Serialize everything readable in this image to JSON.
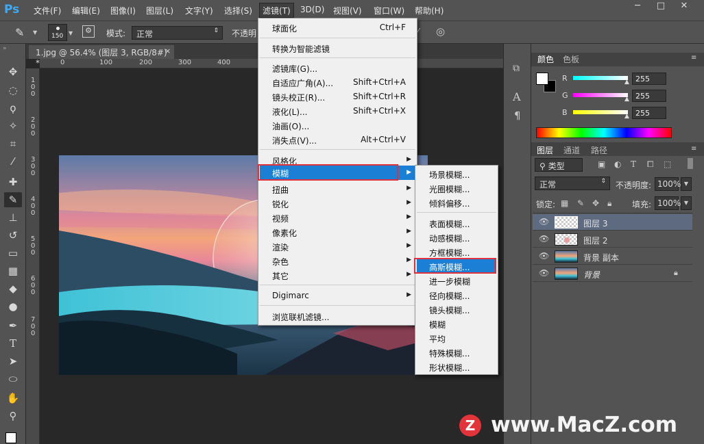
{
  "app": {
    "logo": "Ps"
  },
  "menubar": {
    "items": [
      "文件(F)",
      "编辑(E)",
      "图像(I)",
      "图层(L)",
      "文字(Y)",
      "选择(S)",
      "滤镜(T)",
      "3D(D)",
      "视图(V)",
      "窗口(W)",
      "帮助(H)"
    ],
    "window_controls": [
      "─",
      "□",
      "✕"
    ]
  },
  "options": {
    "brush_size": "150",
    "mode_label": "模式:",
    "mode_value": "正常",
    "opacity_label": "不透明"
  },
  "document": {
    "tab_title": "1.jpg @ 56.4% (图层 3, RGB/8#) *",
    "ruler_h": [
      "0",
      "100",
      "200",
      "300",
      "400"
    ],
    "ruler_v": [
      "1",
      "0",
      "0",
      "2",
      "0",
      "0",
      "3",
      "0",
      "0",
      "4",
      "0",
      "0",
      "5",
      "0",
      "0",
      "6",
      "0",
      "0",
      "7",
      "0",
      "0"
    ]
  },
  "filter_menu": {
    "items": [
      {
        "label": "球面化",
        "shortcut": "Ctrl+F"
      },
      {
        "label": "转换为智能滤镜",
        "shortcut": ""
      },
      {
        "label": "滤镜库(G)...",
        "shortcut": ""
      },
      {
        "label": "自适应广角(A)...",
        "shortcut": "Shift+Ctrl+A"
      },
      {
        "label": "镜头校正(R)...",
        "shortcut": "Shift+Ctrl+R"
      },
      {
        "label": "液化(L)...",
        "shortcut": "Shift+Ctrl+X"
      },
      {
        "label": "油画(O)...",
        "shortcut": ""
      },
      {
        "label": "消失点(V)...",
        "shortcut": "Alt+Ctrl+V"
      },
      {
        "label": "风格化",
        "shortcut": ""
      },
      {
        "label": "模糊",
        "shortcut": ""
      },
      {
        "label": "扭曲",
        "shortcut": ""
      },
      {
        "label": "锐化",
        "shortcut": ""
      },
      {
        "label": "视频",
        "shortcut": ""
      },
      {
        "label": "像素化",
        "shortcut": ""
      },
      {
        "label": "渲染",
        "shortcut": ""
      },
      {
        "label": "杂色",
        "shortcut": ""
      },
      {
        "label": "其它",
        "shortcut": ""
      },
      {
        "label": "Digimarc",
        "shortcut": ""
      },
      {
        "label": "浏览联机滤镜...",
        "shortcut": ""
      }
    ]
  },
  "blur_submenu": {
    "items": [
      "场景模糊...",
      "光圈模糊...",
      "倾斜偏移...",
      "表面模糊...",
      "动感模糊...",
      "方框模糊...",
      "高斯模糊...",
      "进一步模糊",
      "径向模糊...",
      "镜头模糊...",
      "模糊",
      "平均",
      "特殊模糊...",
      "形状模糊..."
    ],
    "highlighted": "高斯模糊..."
  },
  "color_panel": {
    "tabs": [
      "颜色",
      "色板"
    ],
    "r_label": "R",
    "g_label": "G",
    "b_label": "B",
    "r": "255",
    "g": "255",
    "b": "255"
  },
  "layers_panel": {
    "tabs": [
      "图层",
      "通道",
      "路径"
    ],
    "kind_label": "类型",
    "blend_mode": "正常",
    "opacity_label": "不透明度:",
    "opacity": "100%",
    "lock_label": "锁定:",
    "fill_label": "填充:",
    "fill": "100%",
    "layers": [
      "图层 3",
      "图层 2",
      "背景 副本",
      "背景"
    ]
  },
  "watermark": {
    "text": "www.MacZ.com",
    "badge": "Z"
  }
}
